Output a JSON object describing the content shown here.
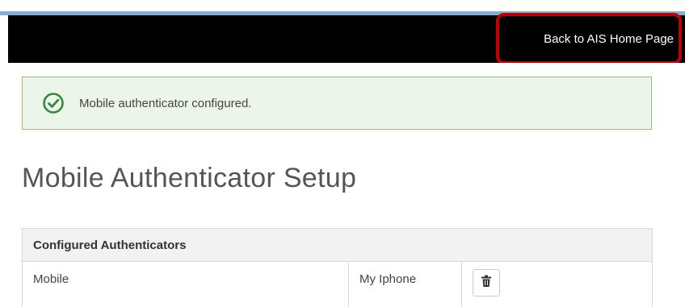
{
  "header": {
    "back_link_label": "Back to AIS Home Page"
  },
  "alert": {
    "message": "Mobile authenticator configured.",
    "icon": "check-circle-icon",
    "color": "#2e8b3a"
  },
  "page": {
    "title": "Mobile Authenticator Setup"
  },
  "authenticators_table": {
    "heading": "Configured Authenticators",
    "rows": [
      {
        "type": "Mobile",
        "name": "My Iphone",
        "action_icon": "trash-icon"
      }
    ]
  },
  "colors": {
    "navbar": "#000000",
    "highlight_border": "#c00000",
    "alert_background": "#ebf6e8",
    "alert_border": "#93c47d"
  }
}
